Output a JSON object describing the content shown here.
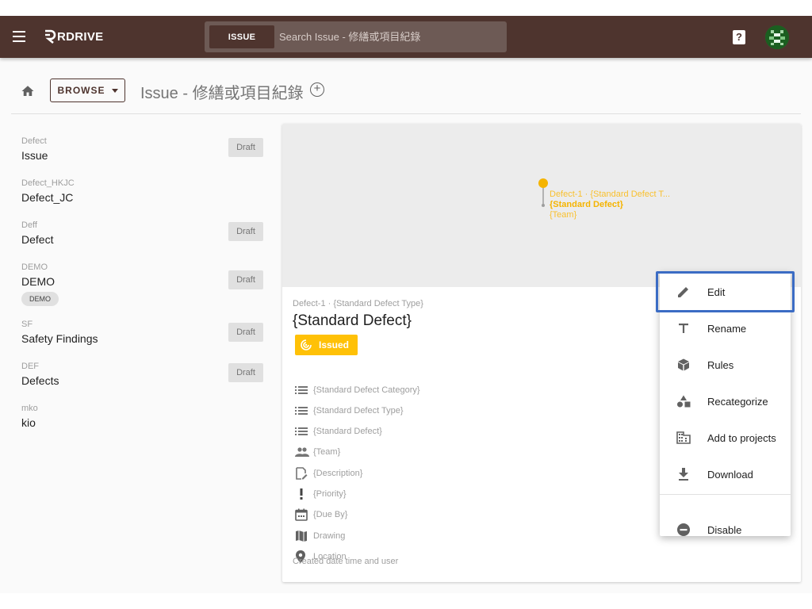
{
  "app": {
    "logo_text": "RDRIVE"
  },
  "search": {
    "chip": "ISSUE",
    "placeholder": "Search Issue - 修繕或項目紀錄"
  },
  "header": {
    "help_glyph": "?"
  },
  "toolbar": {
    "browse_label": "BROWSE",
    "page_title": "Issue - 修繕或項目紀錄",
    "add_glyph": "+"
  },
  "sidebar": {
    "items": [
      {
        "code": "Defect",
        "name": "Issue",
        "badge": "Draft"
      },
      {
        "code": "Defect_HKJC",
        "name": "Defect_JC",
        "badge": ""
      },
      {
        "code": "Deff",
        "name": "Defect",
        "badge": "Draft"
      },
      {
        "code": "DEMO",
        "name": "DEMO",
        "badge": "Draft",
        "tag": "DEMO"
      },
      {
        "code": "SF",
        "name": "Safety Findings",
        "badge": "Draft"
      },
      {
        "code": "DEF",
        "name": "Defects",
        "badge": "Draft"
      },
      {
        "code": "mko",
        "name": "kio",
        "badge": ""
      }
    ]
  },
  "map": {
    "pin_line1": "Defect-1 · {Standard Defect T...",
    "pin_line2": "{Standard Defect}",
    "pin_line3": "{Team}"
  },
  "detail": {
    "subtitle": "Defect-1 · {Standard Defect Type}",
    "title": "{Standard Defect}",
    "status": "Issued",
    "status_color": "#ffc107",
    "fields": [
      {
        "icon": "list-icon",
        "text": "{Standard Defect Category}"
      },
      {
        "icon": "list-icon",
        "text": "{Standard Defect Type}"
      },
      {
        "icon": "list-icon",
        "text": "{Standard Defect}"
      },
      {
        "icon": "people-icon",
        "text": "{Team}"
      },
      {
        "icon": "description-icon",
        "text": "{Description}"
      },
      {
        "icon": "priority-icon",
        "text": "{Priority}"
      },
      {
        "icon": "calendar-icon",
        "text": "{Due By}"
      },
      {
        "icon": "map-icon",
        "text": "Drawing"
      },
      {
        "icon": "location-icon",
        "text": "Location"
      }
    ],
    "footer": "Created date time and user"
  },
  "context_menu": {
    "items": [
      {
        "icon": "pencil-icon",
        "label": "Edit"
      },
      {
        "icon": "text-icon",
        "label": "Rename"
      },
      {
        "icon": "cube-icon",
        "label": "Rules"
      },
      {
        "icon": "shapes-icon",
        "label": "Recategorize"
      },
      {
        "icon": "building-icon",
        "label": "Add to projects"
      },
      {
        "icon": "download-icon",
        "label": "Download"
      },
      {
        "icon": "minus-circle-icon",
        "label": "Disable"
      }
    ],
    "highlighted": "Edit",
    "highlight_color": "#3b6cc4"
  },
  "colors": {
    "brand": "#4e342e",
    "accent": "#ffc107"
  }
}
